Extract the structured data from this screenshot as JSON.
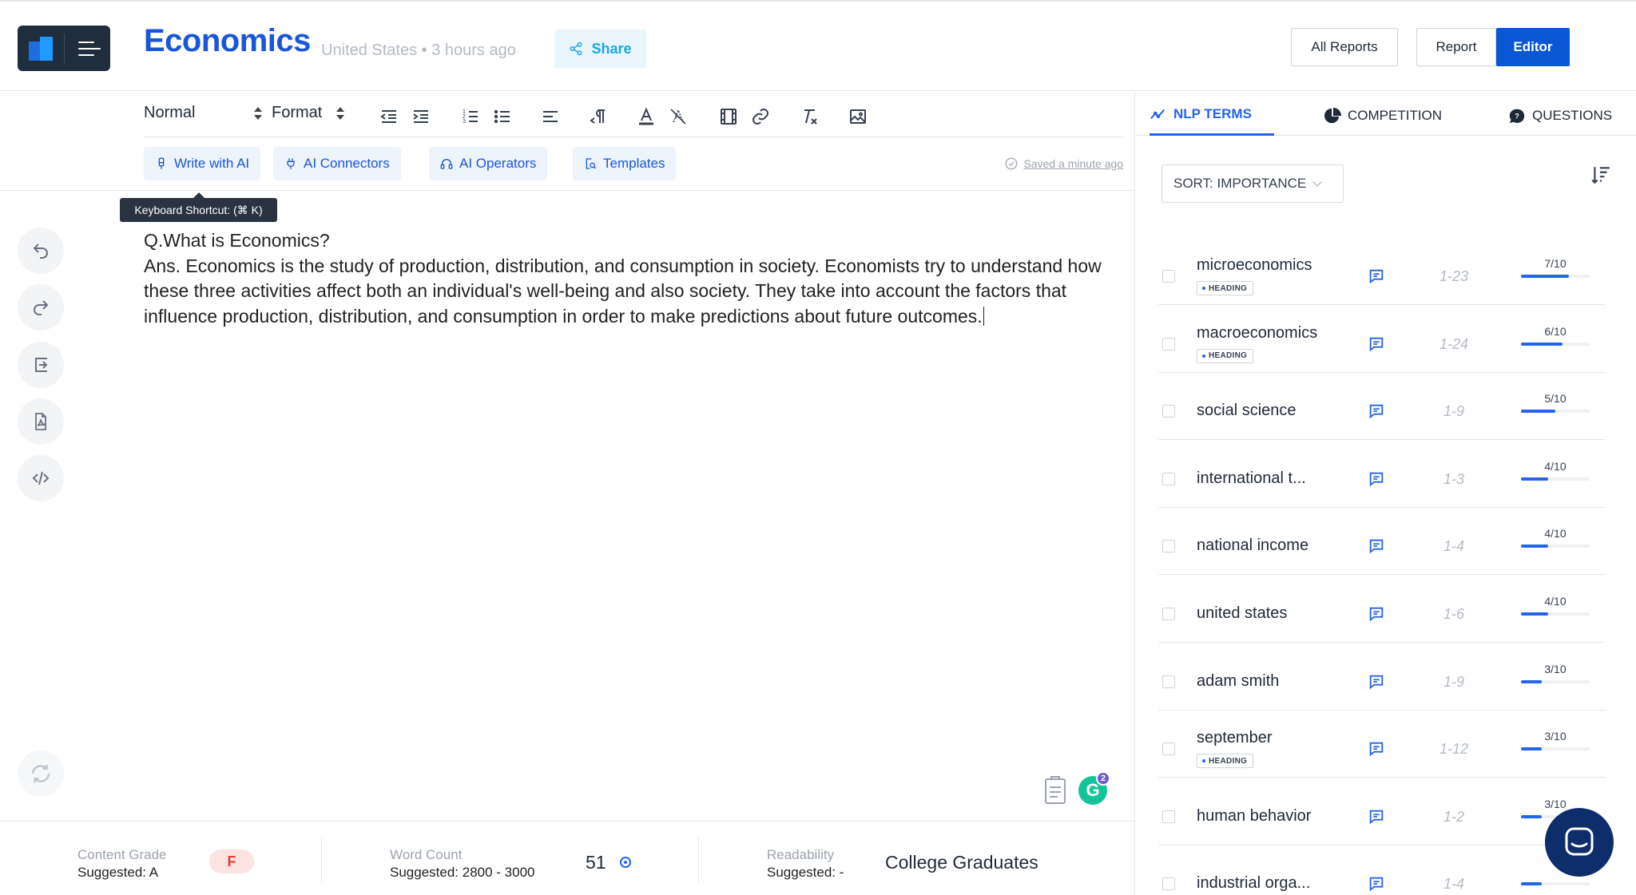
{
  "header": {
    "title": "Economics",
    "location": "United States",
    "separator": "•",
    "time_ago": "3 hours ago",
    "share_label": "Share",
    "all_reports_label": "All Reports",
    "report_label": "Report",
    "editor_label": "Editor"
  },
  "toolbar": {
    "block_style": "Normal",
    "format": "Format"
  },
  "ai_row": {
    "write_with_ai": "Write with AI",
    "ai_connectors": "AI Connectors",
    "ai_operators": "AI Operators",
    "templates": "Templates",
    "saved_status": "Saved a minute ago"
  },
  "tooltip": "Keyboard Shortcut: (⌘ K)",
  "editor": {
    "question": "Q.What is Economics?",
    "answer": "Ans. Economics is the study of production, distribution, and consumption in society. Economists try to understand how these three activities affect both an individual's well-being and also society. They take into account the factors that influence production, distribution, and consumption in order to make predictions about future outcomes."
  },
  "grammarly_count": "2",
  "grammarly_letter": "G",
  "stats": {
    "content_grade_label": "Content Grade",
    "content_grade_suggested": "Suggested: A",
    "content_grade_value": "F",
    "word_count_label": "Word Count",
    "word_count_suggested": "Suggested: 2800 - 3000",
    "word_count_value": "51",
    "readability_label": "Readability",
    "readability_suggested": "Suggested: -",
    "readability_value": "College Graduates"
  },
  "right_panel": {
    "tabs": [
      {
        "label": "NLP TERMS",
        "icon": "trend-line-icon",
        "active": true
      },
      {
        "label": "COMPETITION",
        "icon": "pie-chart-icon",
        "active": false
      },
      {
        "label": "QUESTIONS",
        "icon": "chat-question-icon",
        "active": false
      }
    ],
    "sort_label": "SORT: IMPORTANCE",
    "heading_tag": "HEADING",
    "terms": [
      {
        "name": "microeconomics",
        "heading": true,
        "range": "1-23",
        "score": "7/10",
        "fill": 0.7
      },
      {
        "name": "macroeconomics",
        "heading": true,
        "range": "1-24",
        "score": "6/10",
        "fill": 0.6
      },
      {
        "name": "social science",
        "heading": false,
        "range": "1-9",
        "score": "5/10",
        "fill": 0.5
      },
      {
        "name": "international t...",
        "heading": false,
        "range": "1-3",
        "score": "4/10",
        "fill": 0.4
      },
      {
        "name": "national income",
        "heading": false,
        "range": "1-4",
        "score": "4/10",
        "fill": 0.4
      },
      {
        "name": "united states",
        "heading": false,
        "range": "1-6",
        "score": "4/10",
        "fill": 0.4
      },
      {
        "name": "adam smith",
        "heading": false,
        "range": "1-9",
        "score": "3/10",
        "fill": 0.3
      },
      {
        "name": "september",
        "heading": true,
        "range": "1-12",
        "score": "3/10",
        "fill": 0.3
      },
      {
        "name": "human behavior",
        "heading": false,
        "range": "1-2",
        "score": "3/10",
        "fill": 0.3
      },
      {
        "name": "industrial orga...",
        "heading": false,
        "range": "1-4",
        "score": "",
        "fill": 0.3
      }
    ]
  },
  "colors": {
    "brand_blue": "#1a56db",
    "primary_button": "#0a56d4",
    "grade_fail": "#e0443a",
    "grammarly_green": "#15c39a"
  }
}
